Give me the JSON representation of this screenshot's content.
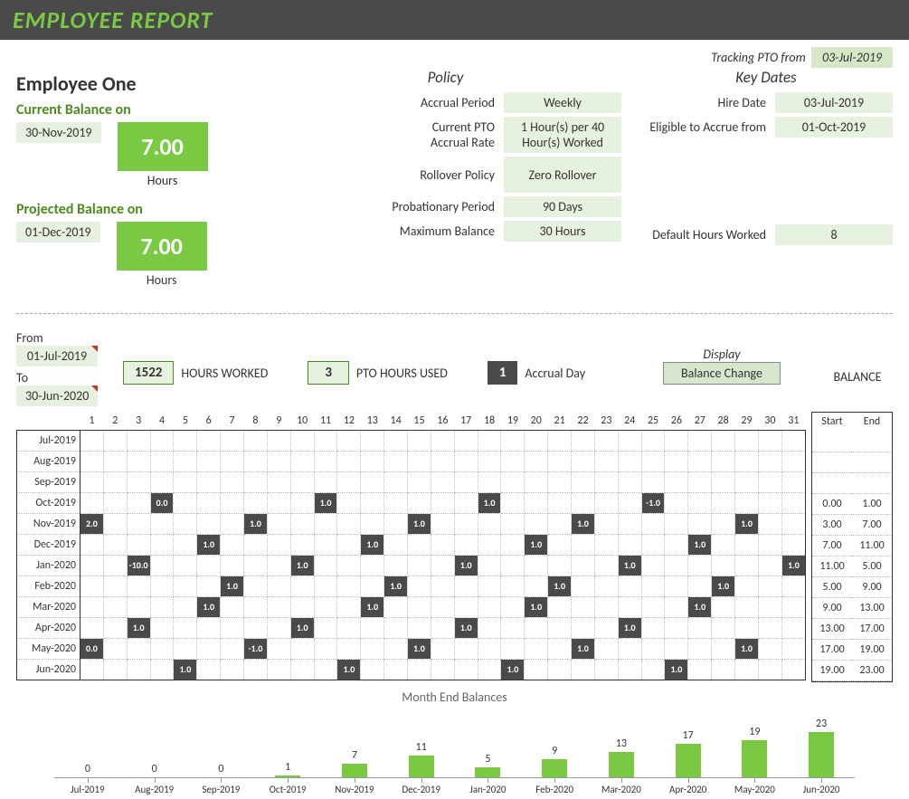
{
  "title": "EMPLOYEE REPORT",
  "tracking_label": "Tracking PTO from",
  "tracking_date": "03-Jul-2019",
  "employee_name": "Employee One",
  "current": {
    "label": "Current Balance on",
    "date": "30-Nov-2019",
    "value": "7.00",
    "unit": "Hours"
  },
  "projected": {
    "label": "Projected Balance on",
    "date": "01-Dec-2019",
    "value": "7.00",
    "unit": "Hours"
  },
  "policy": {
    "heading": "Policy",
    "rows": [
      {
        "k": "Accrual Period",
        "v": "Weekly"
      },
      {
        "k": "Current PTO Accrual Rate",
        "v": "1 Hour(s) per 40 Hour(s) Worked"
      },
      {
        "k": "Rollover Policy",
        "v": "Zero Rollover"
      },
      {
        "k": "Probationary Period",
        "v": "90 Days"
      },
      {
        "k": "Maximum Balance",
        "v": "30 Hours"
      }
    ]
  },
  "keydates": {
    "heading": "Key Dates",
    "rows": [
      {
        "k": "Hire Date",
        "v": "03-Jul-2019"
      },
      {
        "k": "Eligible to Accrue from",
        "v": "01-Oct-2019"
      },
      {
        "k": "Default Hours Worked",
        "v": "8"
      }
    ]
  },
  "range": {
    "from_label": "From",
    "from": "01-Jul-2019",
    "to_label": "To",
    "to": "30-Jun-2020"
  },
  "stats": {
    "hours_worked": "1522",
    "hours_worked_label": "HOURS WORKED",
    "pto_used": "3",
    "pto_used_label": "PTO HOURS USED",
    "accrual_day": "1",
    "accrual_day_label": "Accrual Day"
  },
  "display": {
    "label": "Display",
    "button": "Balance Change"
  },
  "balance_label": "BALANCE",
  "balance_headers": {
    "start": "Start",
    "end": "End"
  },
  "days": [
    "1",
    "2",
    "3",
    "4",
    "5",
    "6",
    "7",
    "8",
    "9",
    "10",
    "11",
    "12",
    "13",
    "14",
    "15",
    "16",
    "17",
    "18",
    "19",
    "20",
    "21",
    "22",
    "23",
    "24",
    "25",
    "26",
    "27",
    "28",
    "29",
    "30",
    "31"
  ],
  "calendar": [
    {
      "month": "Jul-2019",
      "cells": {},
      "start": "",
      "end": ""
    },
    {
      "month": "Aug-2019",
      "cells": {},
      "start": "",
      "end": ""
    },
    {
      "month": "Sep-2019",
      "cells": {},
      "start": "",
      "end": ""
    },
    {
      "month": "Oct-2019",
      "cells": {
        "4": "0.0",
        "11": "1.0",
        "18": "1.0",
        "25": "-1.0"
      },
      "start": "0.00",
      "end": "1.00"
    },
    {
      "month": "Nov-2019",
      "cells": {
        "1": "2.0",
        "8": "1.0",
        "15": "1.0",
        "22": "1.0",
        "29": "1.0"
      },
      "start": "3.00",
      "end": "7.00"
    },
    {
      "month": "Dec-2019",
      "cells": {
        "6": "1.0",
        "13": "1.0",
        "20": "1.0",
        "27": "1.0"
      },
      "start": "7.00",
      "end": "11.00"
    },
    {
      "month": "Jan-2020",
      "cells": {
        "3": "-10.0",
        "10": "1.0",
        "17": "1.0",
        "24": "1.0",
        "31": "1.0"
      },
      "start": "11.00",
      "end": "5.00"
    },
    {
      "month": "Feb-2020",
      "cells": {
        "7": "1.0",
        "14": "1.0",
        "21": "1.0",
        "28": "1.0"
      },
      "start": "5.00",
      "end": "9.00"
    },
    {
      "month": "Mar-2020",
      "cells": {
        "6": "1.0",
        "13": "1.0",
        "20": "1.0",
        "27": "1.0"
      },
      "start": "9.00",
      "end": "13.00"
    },
    {
      "month": "Apr-2020",
      "cells": {
        "3": "1.0",
        "10": "1.0",
        "17": "1.0",
        "24": "1.0"
      },
      "start": "13.00",
      "end": "17.00"
    },
    {
      "month": "May-2020",
      "cells": {
        "1": "0.0",
        "8": "-1.0",
        "15": "1.0",
        "22": "1.0",
        "29": "1.0"
      },
      "start": "17.00",
      "end": "19.00"
    },
    {
      "month": "Jun-2020",
      "cells": {
        "5": "1.0",
        "12": "1.0",
        "19": "1.0",
        "26": "1.0"
      },
      "start": "19.00",
      "end": "23.00"
    }
  ],
  "chart_data": {
    "type": "bar",
    "title": "Month End Balances",
    "categories": [
      "Jul-2019",
      "Aug-2019",
      "Sep-2019",
      "Oct-2019",
      "Nov-2019",
      "Dec-2019",
      "Jan-2020",
      "Feb-2020",
      "Mar-2020",
      "Apr-2020",
      "May-2020",
      "Jun-2020"
    ],
    "values": [
      0,
      0,
      0,
      1,
      7,
      11,
      5,
      9,
      13,
      17,
      19,
      23
    ],
    "xlabel": "",
    "ylabel": "",
    "ylim": [
      0,
      23
    ]
  }
}
